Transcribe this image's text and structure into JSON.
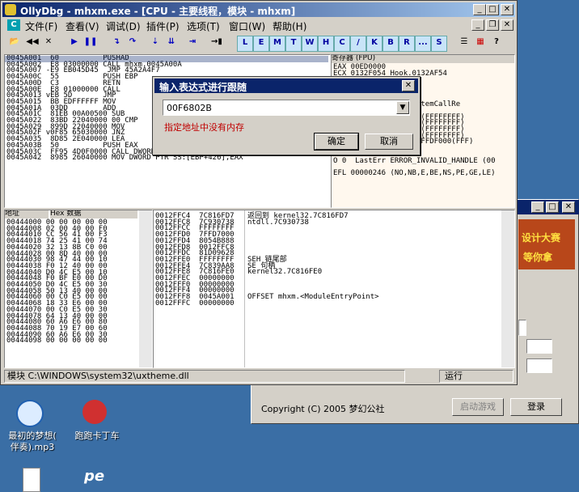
{
  "bg_window": {
    "copyright": "Copyright (C) 2005 梦幻公社",
    "start_label": "启动游戏",
    "login_label": "登录",
    "banner_line1": "设计大赛",
    "banner_line2": "等你拿"
  },
  "main": {
    "title": "OllyDbg - mhxm.exe - [CPU - 主要线程，模块 - mhxm]",
    "menu": [
      "文件(F)",
      "查看(V)",
      "调试(D)",
      "插件(P)",
      "选项(T)",
      "窗口(W)",
      "帮助(H)"
    ],
    "toolbar_letters": [
      "L",
      "E",
      "M",
      "T",
      "W",
      "H",
      "C",
      "/",
      "K",
      "B",
      "R",
      "...",
      "S"
    ],
    "disasm_lines": "0045A001  60          PUSHAD\n0045A002  E8 03000000 CALL mhxm.0045A00A\n0045A007 -E9 EB045D45  JMP 45A2A4F7\n0045A00C  55          PUSH EBP\n0045A00D  C3          RETN\n0045A00E  E8 01000000 CALL\n0045A013 vEB 5D       JMP\n0045A015  BB EDFFFFFF MOV\n0045A01A  03DD        ADD\n0045A01C  81EB 00A00500 SUB\n0045A022  83BD 22040000 00 CMP\n0045A029  899D 22040000 MOV\n0045A02F v0F85 65030000 JNZ\n0045A035  8D85 2E040000 LEA\n0045A03B  50          PUSH EAX\n0045A03C  FF95 4D0F0000 CALL DWORD PTR SS:[EBP+F4D]\n0045A042  8985 26040000 MOV DWORD PTR SS:[EBP+426],EAX",
    "regs_header": "寄存器 (FPU)",
    "regs_lines": "EAX 00ED0000\nECX 0132F054 Hook.0132AF54\n\n\n\n\n          .KiFastSystemCallRe\n\nE 0  ES 0023 32bit 0(FFFFFFFF)\nP 1  CS 001B 32bit 0(FFFFFFFF)\nA 0  SS 0023 32bit 0(FFFFFFFF)\nZ 1  DS 0023 32bit 0(FFFFFFFF)\nS 0  FS 003B 32bit 7FFDF000(FFF)\nT 0  GS 0000 NULL\nD 0\nO 0  LastErr ERROR_INVALID_HANDLE (00\n\nEFL 00000246 (NO,NB,E,BE,NS,PE,GE,LE)",
    "dump_header_addr": "地址",
    "dump_header_hex": "Hex 数据",
    "dump_lines": "00444000 00 00 00 00 00\n00444008 02 00 40 00 F0\n00444010 CC 56 41 00 F3\n00444018 74 25 41 00 74\n00444020 32 13 8B C0 00\n00444028 00 8D 40 00 00\n00444030 98 47 44 00 10\n00444038 F0 12 40 00 00\n00444040 D0 4C E5 00 10\n00444048 F0 BF E0 00 D0\n00444050 D0 4C E5 00 30\n00444058 50 13 40 00 00\n00444060 00 C0 E5 00 00\n00444068 18 33 E6 00 00\n00444070 00 C0 E5 00 30\n00444078 64 13 40 00 00\n00444080 60 A6 E6 00 80\n00444088 70 19 E7 00 60\n00444090 60 A6 E6 00 30\n00444098 00 00 00 00 00",
    "stack_addrs": "0012FFC4  7C816FD7\n0012FFC8  7C930738\n0012FFCC  FFFFFFFF\n0012FFD0  7FFD7000\n0012FFD4  8054B888\n0012FFD8  0012FFC8\n0012FFDC  81D09628\n0012FFE0  FFFFFFFF\n0012FFE4  7C839AA8\n0012FFE8  7C816FE0\n0012FFEC  00000000\n0012FFF0  00000000\n0012FFF4  00000000\n0012FFF8  0045A001\n0012FFFC  00000000",
    "stack_comments": "返回到 kernel32.7C816FD7\nntdll.7C930738\n\n\n\n\n\nSEH 链尾部\nSE 句柄\nkernel32.7C816FE0\n\n\n\nOFFSET mhxm.<ModuleEntryPoint>",
    "status_text": "模块 C:\\WINDOWS\\system32\\uxtheme.dll",
    "status_right": "运行"
  },
  "dialog": {
    "title": "输入表达式进行跟随",
    "input_value": "00F6802B",
    "error_text": "指定地址中没有内存",
    "ok_label": "确定",
    "cancel_label": "取消"
  },
  "desktop": {
    "icon1_label_line1": "最初的梦想(",
    "icon1_label_line2": "伴奏).mp3",
    "icon2_label": "跑跑卡丁车"
  }
}
